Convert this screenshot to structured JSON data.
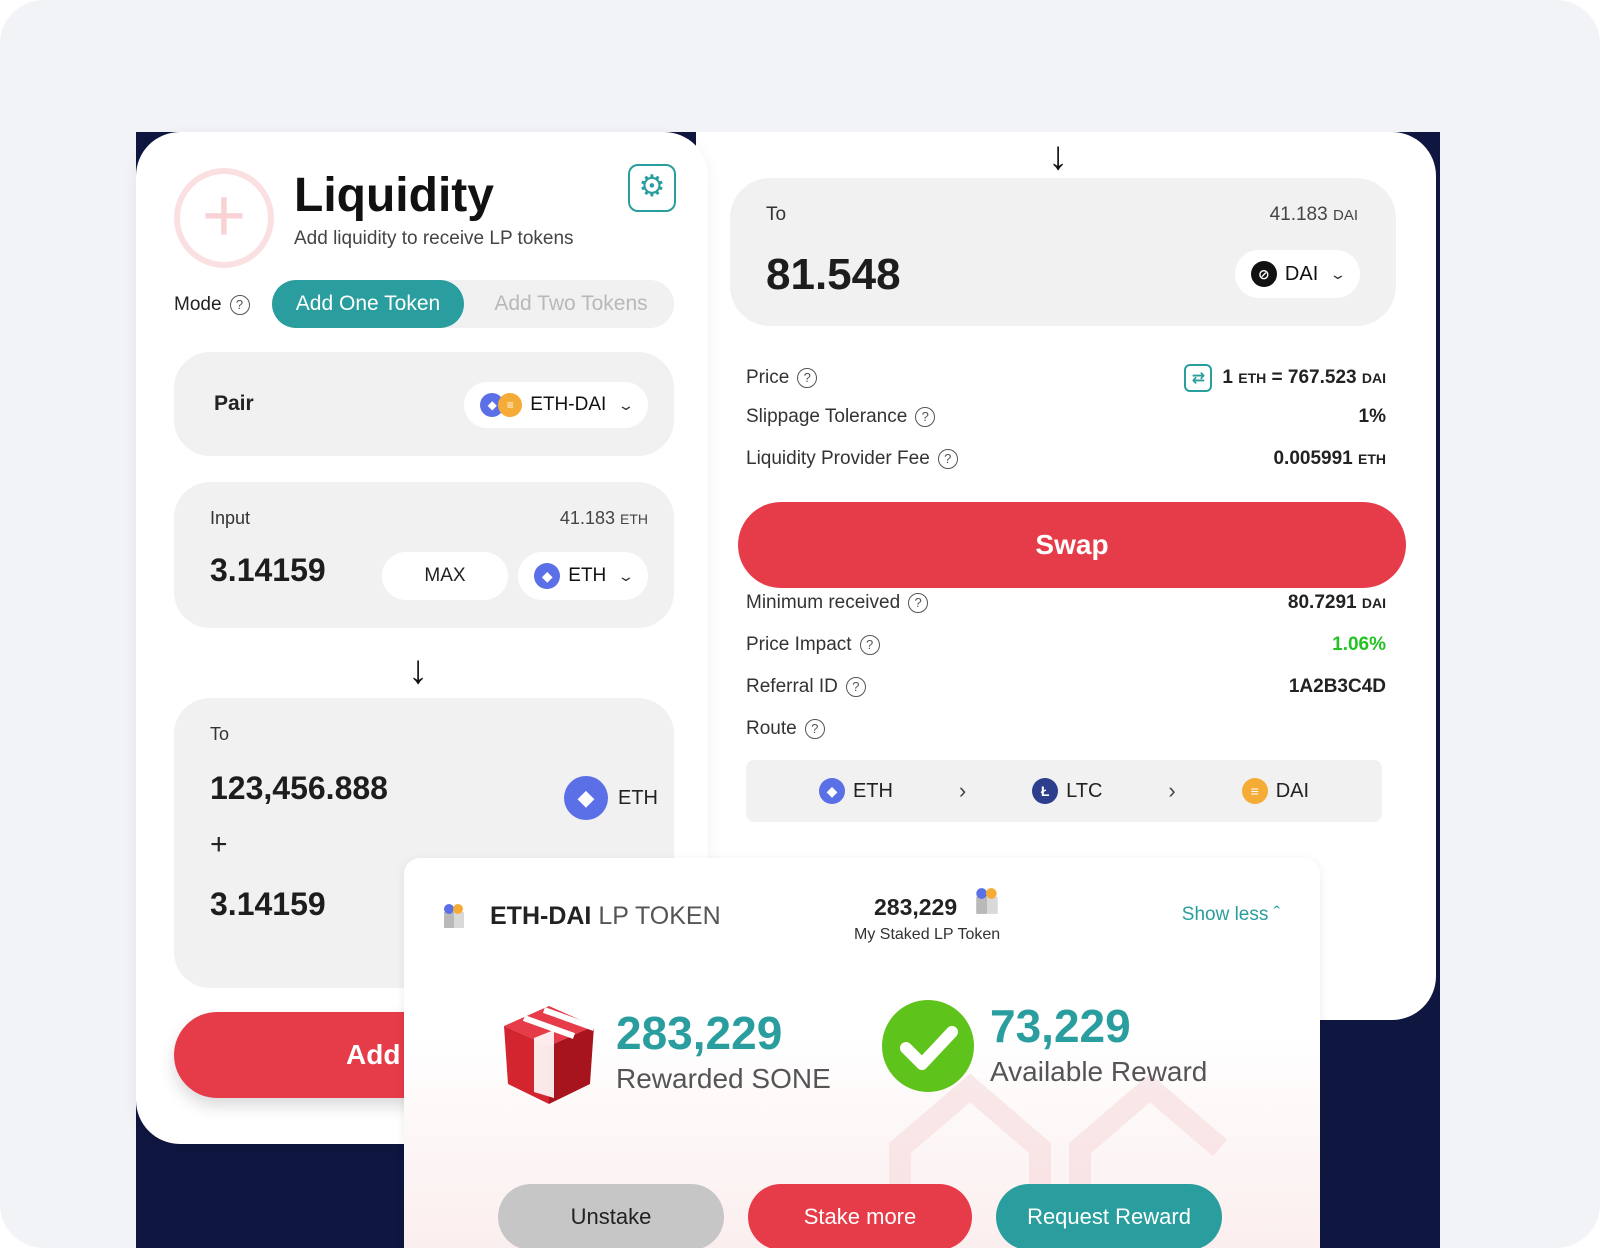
{
  "swap": {
    "to_label": "To",
    "to_balance": "41.183",
    "to_balance_unit": "DAI",
    "to_amount": "81.548",
    "to_token": "DAI",
    "price_label": "Price",
    "price_value": "1",
    "price_unit_from": "ETH",
    "price_equals": "= 767.523",
    "price_unit_to": "DAI",
    "slippage_label": "Slippage Tolerance",
    "slippage_value": "1%",
    "fee_label": "Liquidity Provider Fee",
    "fee_value": "0.005991",
    "fee_unit": "ETH",
    "swap_button": "Swap",
    "min_received_label": "Minimum received",
    "min_received_value": "80.7291",
    "min_received_unit": "DAI",
    "price_impact_label": "Price Impact",
    "price_impact_value": "1.06%",
    "referral_label": "Referral ID",
    "referral_value": "1A2B3C4D",
    "route_label": "Route",
    "route": [
      "ETH",
      "LTC",
      "DAI"
    ]
  },
  "liquidity": {
    "title": "Liquidity",
    "subtitle": "Add liquidity to receive LP tokens",
    "mode_label": "Mode",
    "mode_options": [
      "Add One Token",
      "Add Two Tokens"
    ],
    "pair_label": "Pair",
    "pair_value": "ETH-DAI",
    "input_label": "Input",
    "input_balance": "41.183",
    "input_balance_unit": "ETH",
    "input_amount": "3.14159",
    "max_button": "MAX",
    "input_token": "ETH",
    "to_label": "To",
    "to_amount_1": "123,456.888",
    "to_token": "ETH",
    "plus": "+",
    "to_amount_2": "3.14159",
    "add_button": "Add L"
  },
  "lp_token": {
    "name_bold": "ETH-DAI",
    "name_rest": " LP TOKEN",
    "staked_value": "283,229",
    "staked_label": "My Staked LP Token",
    "show_less": "Show less",
    "rewarded_value": "283,229",
    "rewarded_label": "Rewarded SONE",
    "available_value": "73,229",
    "available_label": "Available Reward",
    "unstake_button": "Unstake",
    "stake_more_button": "Stake more",
    "request_reward_button": "Request Reward"
  },
  "colors": {
    "accent": "#2a9e9e",
    "primary_red": "#e63b49",
    "navy_bg": "#0f1640",
    "positive": "#22c322"
  }
}
